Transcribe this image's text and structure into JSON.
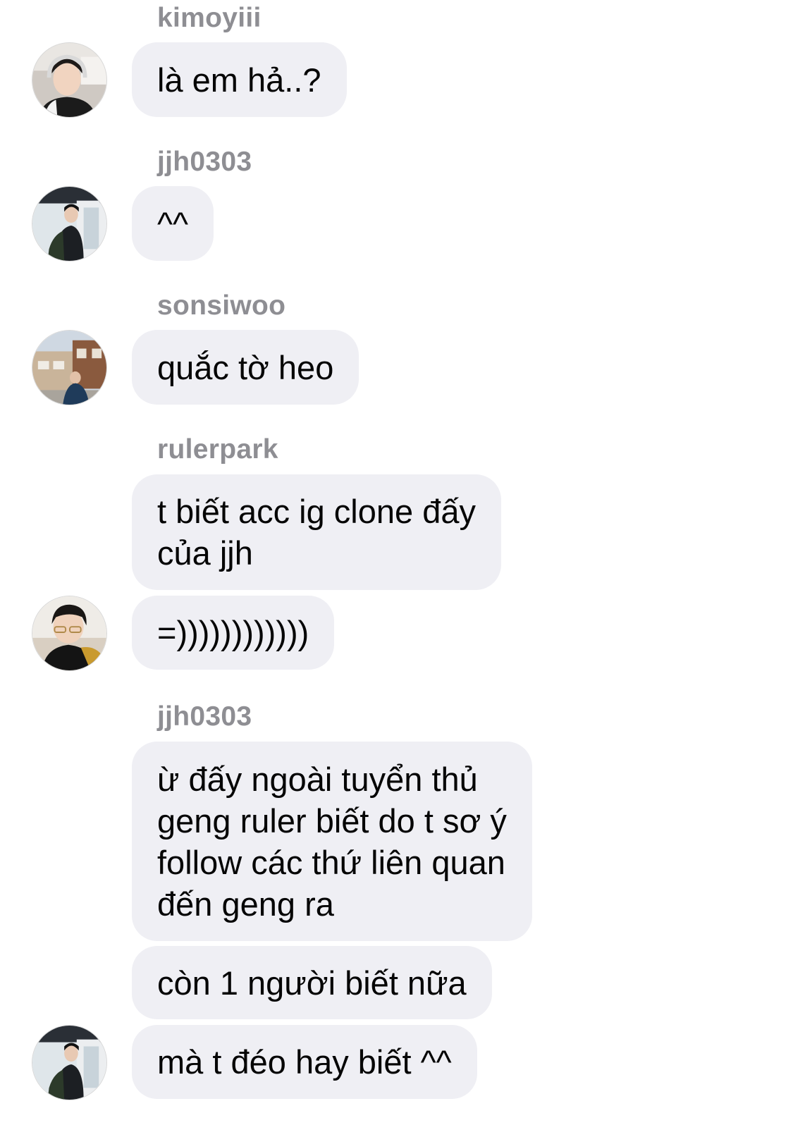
{
  "chat": {
    "messages": [
      {
        "sender": "kimoyiii",
        "text": "là em hả..?"
      },
      {
        "sender": "jjh0303",
        "text": "^^"
      },
      {
        "sender": "sonsiwoo",
        "text": "quắc tờ heo"
      },
      {
        "sender": "rulerpark",
        "text": "t biết acc ig clone đấy\ncủa jjh"
      },
      {
        "sender": "rulerpark",
        "text": "=))))))))))))"
      },
      {
        "sender": "jjh0303",
        "text": "ừ đấy ngoài tuyển thủ\ngeng ruler biết do t sơ ý\nfollow các thứ liên quan\nđến geng ra"
      },
      {
        "sender": "jjh0303",
        "text": "còn 1 người biết nữa"
      },
      {
        "sender": "jjh0303",
        "text": "mà t đéo hay biết ^^"
      }
    ]
  }
}
